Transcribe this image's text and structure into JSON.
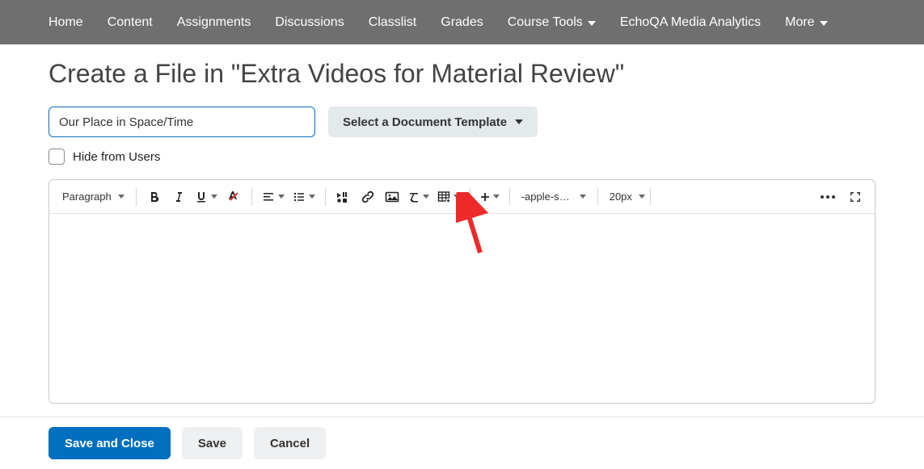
{
  "nav": {
    "items": [
      {
        "label": "Home",
        "hasDropdown": false
      },
      {
        "label": "Content",
        "hasDropdown": false
      },
      {
        "label": "Assignments",
        "hasDropdown": false
      },
      {
        "label": "Discussions",
        "hasDropdown": false
      },
      {
        "label": "Classlist",
        "hasDropdown": false
      },
      {
        "label": "Grades",
        "hasDropdown": false
      },
      {
        "label": "Course Tools",
        "hasDropdown": true
      },
      {
        "label": "EchoQA Media Analytics",
        "hasDropdown": false
      },
      {
        "label": "More",
        "hasDropdown": true
      }
    ]
  },
  "page": {
    "title": "Create a File in \"Extra Videos for Material Review\""
  },
  "form": {
    "titleValue": "Our Place in Space/Time",
    "templateBtn": "Select a Document Template",
    "hideLabel": "Hide from Users"
  },
  "toolbar": {
    "blockFormat": "Paragraph",
    "fontFamily": "-apple-syste...",
    "fontSize": "20px"
  },
  "footer": {
    "saveClose": "Save and Close",
    "save": "Save",
    "cancel": "Cancel"
  }
}
